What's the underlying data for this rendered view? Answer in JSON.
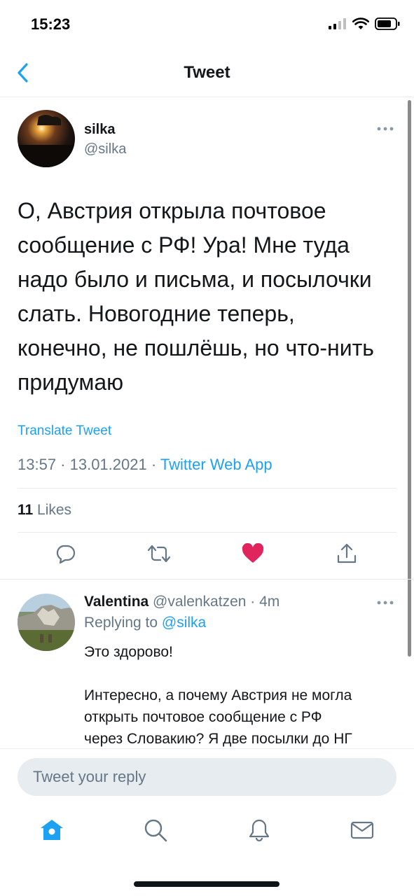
{
  "status_bar": {
    "time": "15:23"
  },
  "header": {
    "title": "Tweet"
  },
  "tweet": {
    "author_name": "silka",
    "author_handle": "@silka",
    "text": "О, Австрия открыла почтовое\nсообщение с РФ! Ура! Мне туда\nнадо было и письма, и посылочки\nслать. Новогодние теперь,\nконечно, не пошлёшь, но что-нить\nпридумаю",
    "translate_label": "Translate Tweet",
    "timestamp": "13:57 · 13.01.2021 · ",
    "source_app": "Twitter Web App",
    "likes_count": "11",
    "likes_label": " Likes",
    "liked": true
  },
  "reply": {
    "author_name": "Valentina",
    "author_handle": " @valenkatzen · 4m",
    "replying_prefix": "Replying to ",
    "replying_to": "@silka",
    "text": "Это здорово!\n\nИнтересно, а почему Австрия не могла\nоткрыть почтовое сообщение с РФ\nчерез Словакию? Я две посылки до НГ"
  },
  "compose": {
    "placeholder": "Tweet your reply"
  },
  "icons": {
    "back": "chevron-left-icon",
    "more": "more-horizontal-icon",
    "reply": "comment-icon",
    "retweet": "retweet-icon",
    "like": "heart-filled-icon",
    "share": "share-icon",
    "home": "home-icon",
    "search": "search-icon",
    "notifications": "bell-icon",
    "messages": "mail-icon"
  },
  "colors": {
    "accent": "#1da1f2",
    "like": "#e0245e",
    "secondary_text": "#657786"
  }
}
